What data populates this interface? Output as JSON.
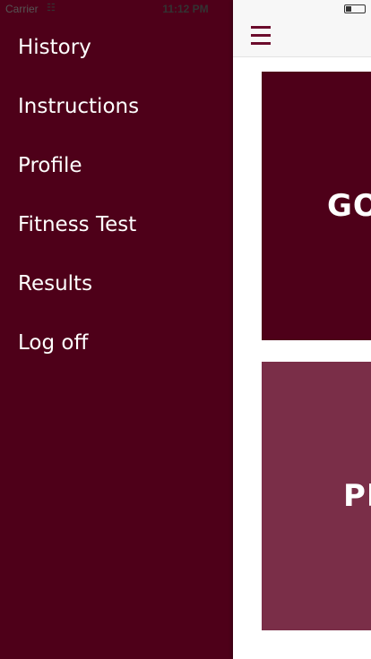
{
  "status_bar": {
    "carrier": "Carrier",
    "time": "11:12 PM",
    "wifi_icon": "wifi-icon",
    "battery_icon": "battery-icon"
  },
  "drawer": {
    "items": [
      {
        "label": "History"
      },
      {
        "label": "Instructions"
      },
      {
        "label": "Profile"
      },
      {
        "label": "Fitness Test"
      },
      {
        "label": "Results"
      },
      {
        "label": "Log off"
      }
    ]
  },
  "main": {
    "menu_icon": "hamburger-menu-icon",
    "tiles": [
      {
        "label": "GO"
      },
      {
        "label": "PR"
      }
    ]
  },
  "colors": {
    "drawer_bg": "#4e0019",
    "tile_primary": "#4e0019",
    "tile_secondary": "#7a2e48",
    "accent": "#6b0b2c"
  }
}
